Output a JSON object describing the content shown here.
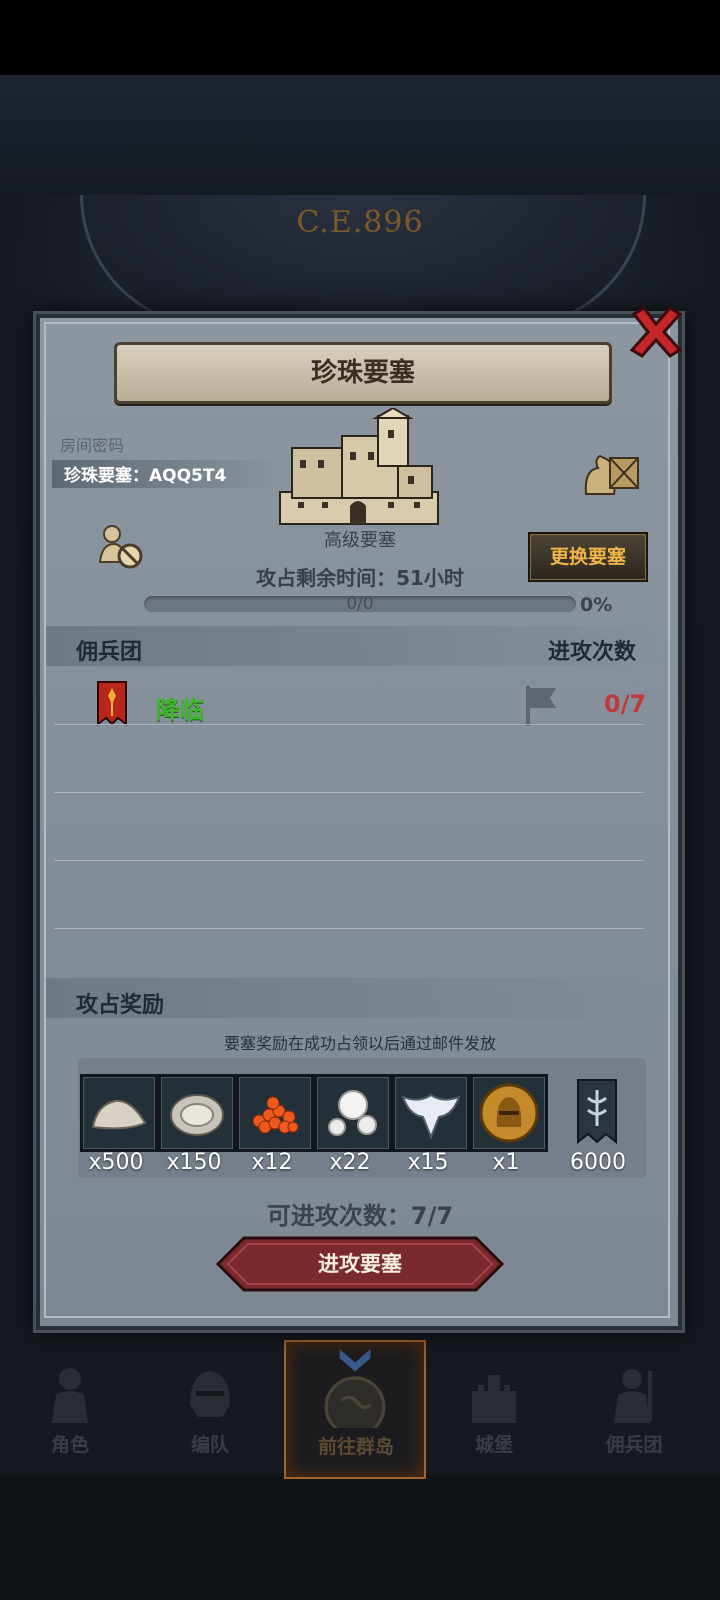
{
  "background": {
    "year": "C.E.896"
  },
  "dialog": {
    "title": "珍珠要塞",
    "room_password_label": "房间密码",
    "room_password_value": "珍珠要塞：AQQ5T4",
    "fortress_level": "高级要塞",
    "time_left": "攻占剩余时间：51小时",
    "change_button": "更换要塞",
    "progress": {
      "text": "0/0",
      "percent_label": "0%",
      "fraction": 0
    }
  },
  "mercenary_section": {
    "col_name": "佣兵团",
    "col_attacks": "进攻次数",
    "rows": [
      {
        "name": "降临",
        "attacks": "0/7"
      }
    ]
  },
  "rewards": {
    "title": "攻占奖励",
    "note": "要塞奖励在成功占领以后通过邮件发放",
    "items": [
      {
        "icon": "clay-icon",
        "qty": "x500"
      },
      {
        "icon": "oyster-icon",
        "qty": "x150"
      },
      {
        "icon": "roe-icon",
        "qty": "x12"
      },
      {
        "icon": "pearl-icon",
        "qty": "x22"
      },
      {
        "icon": "winged-emblem-icon",
        "qty": "x15"
      },
      {
        "icon": "helmet-coin-icon",
        "qty": "x1"
      },
      {
        "icon": "guild-banner-icon",
        "qty": "6000"
      }
    ]
  },
  "attack_count": "可进攻次数：7/7",
  "attack_button": "进攻要塞",
  "bottom_nav": {
    "tabs": [
      {
        "label": "角色",
        "active": false
      },
      {
        "label": "编队",
        "active": false
      },
      {
        "label": "前往群岛",
        "active": true
      },
      {
        "label": "城堡",
        "active": false
      },
      {
        "label": "佣兵团",
        "active": false
      }
    ]
  },
  "colors": {
    "accent_gold": "#f0b548",
    "guild_green": "#3db82a",
    "attacks_red": "#c0383c",
    "button_red": "#7a2a2c"
  }
}
